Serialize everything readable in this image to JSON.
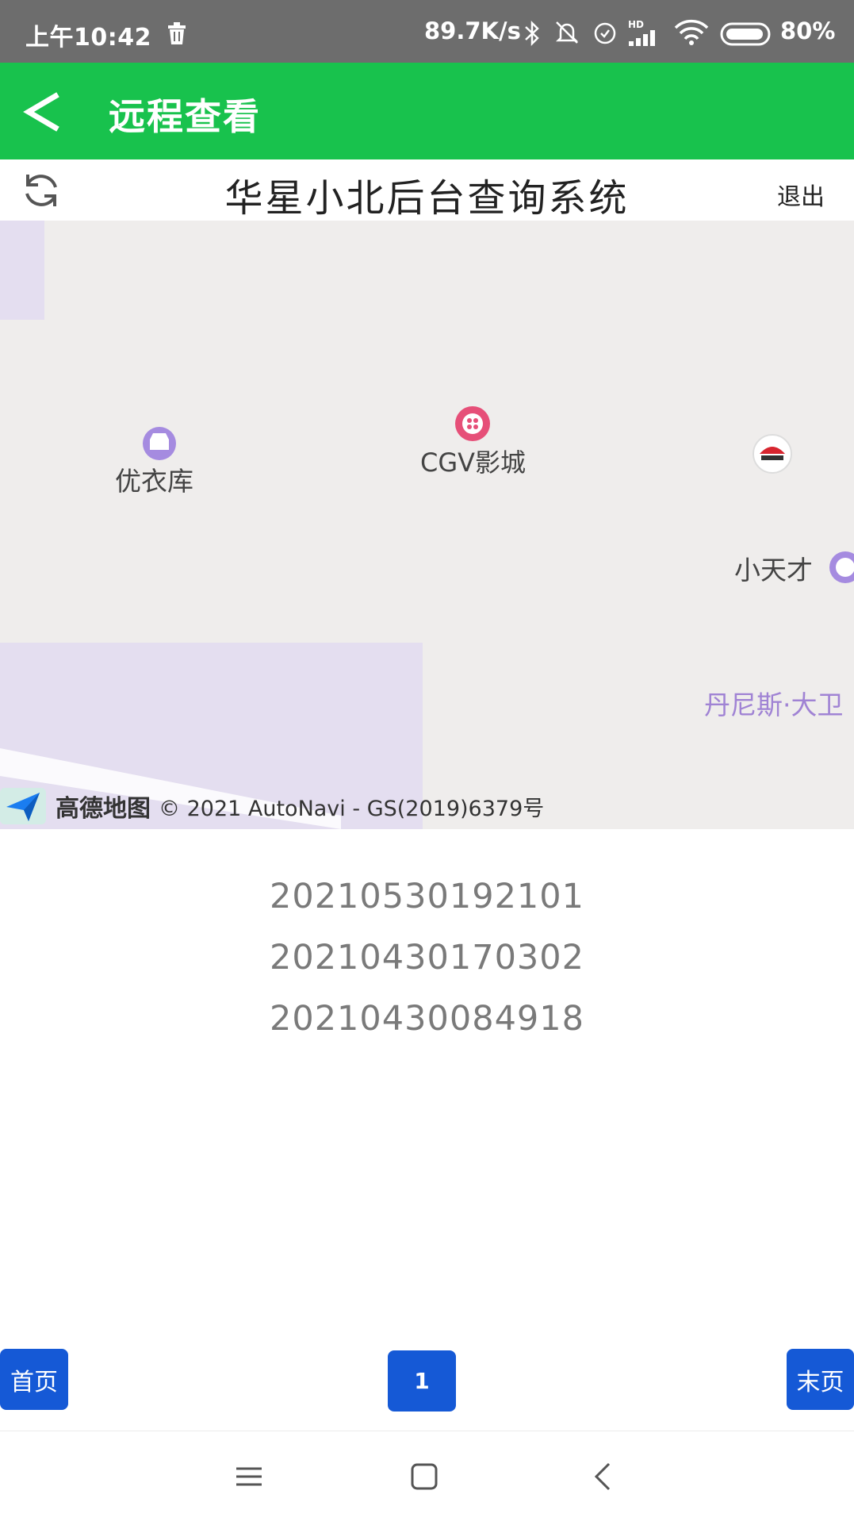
{
  "status_bar": {
    "time": "上午10:42",
    "network_speed": "89.7K/s",
    "hd_label": "HD",
    "battery": "80%"
  },
  "header": {
    "title": "远程查看"
  },
  "sub_header": {
    "title": "华星小北后台查询系统",
    "exit_label": "退出"
  },
  "map": {
    "pois": [
      {
        "label": "优衣库"
      },
      {
        "label": "CGV影城"
      },
      {
        "label": "小天才"
      },
      {
        "label": "丹尼斯·大卫"
      }
    ],
    "brand": "高德地图",
    "copyright": "© 2021 AutoNavi - GS(2019)6379号"
  },
  "records": [
    {
      "value": "20210530192101"
    },
    {
      "value": "20210430170302"
    },
    {
      "value": "20210430084918"
    }
  ],
  "pagination": {
    "first_label": "首页",
    "current_page": "1",
    "last_label": "末页"
  },
  "colors": {
    "header_green": "#18c24d",
    "button_blue": "#1559d6"
  },
  "icons": {
    "back": "back-arrow-icon",
    "refresh": "refresh-icon"
  }
}
